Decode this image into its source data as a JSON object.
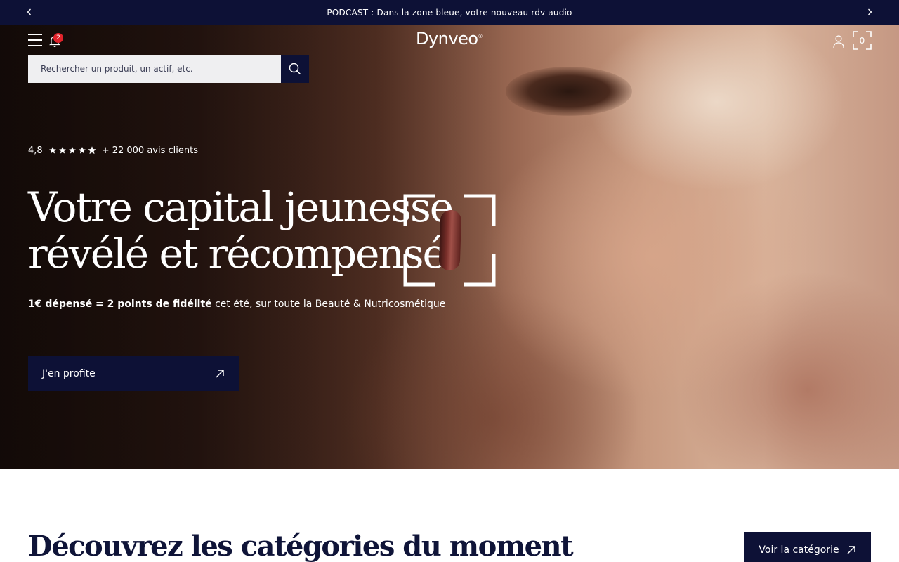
{
  "announcement": {
    "text": "PODCAST : Dans la zone bleue, votre nouveau rdv audio",
    "prev_icon": "chevron-left-icon",
    "next_icon": "chevron-right-icon"
  },
  "header": {
    "logo": "Dynveo",
    "logo_mark": "®",
    "notifications_count": "2",
    "cart_count": "0"
  },
  "search": {
    "placeholder": "Rechercher un produit, un actif, etc."
  },
  "hero": {
    "rating_value": "4,8",
    "rating_stars": 4.8,
    "rating_text": "+ 22 000 avis clients",
    "headline_line1": "Votre capital jeunesse,",
    "headline_line2": "révélé et récompensé",
    "subtitle_bold": "1€ dépensé = 2 points de fidélité",
    "subtitle_rest": " cet été, sur toute la Beauté & Nutricosmétique",
    "cta_label": "J'en profite"
  },
  "categories": {
    "title": "Découvrez les catégories du moment",
    "button_label": "Voir la catégorie"
  },
  "colors": {
    "navy": "#0d1136",
    "badge_red": "#e0232b"
  }
}
